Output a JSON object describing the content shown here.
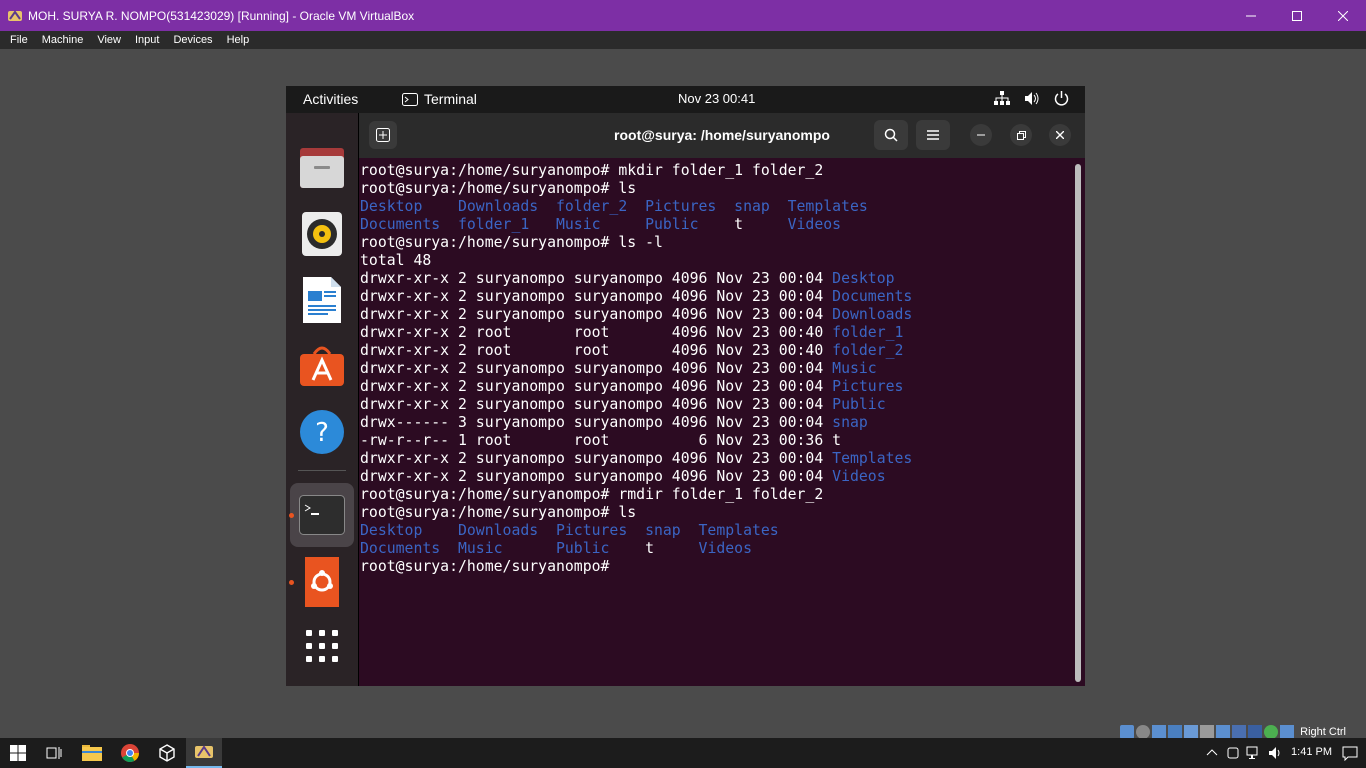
{
  "window": {
    "title": "MOH. SURYA R. NOMPO(531423029) [Running] - Oracle VM VirtualBox"
  },
  "menu": [
    "File",
    "Machine",
    "View",
    "Input",
    "Devices",
    "Help"
  ],
  "topbar": {
    "activities": "Activities",
    "app": "Terminal",
    "clock": "Nov 23  00:41"
  },
  "dock": {
    "items": [
      "files-icon",
      "rhythmbox-icon",
      "libreoffice-writer-icon",
      "app-center-icon",
      "help-icon",
      "terminal-icon",
      "ubuntu-icon",
      "show-apps-icon"
    ]
  },
  "terminal": {
    "title": "root@surya: /home/suryanompo",
    "lines": [
      [
        [
          "root@surya:/home/suryanompo# mkdir folder_1 folder_2",
          "w"
        ]
      ],
      [
        [
          "root@surya:/home/suryanompo# ls",
          "w"
        ]
      ],
      [
        [
          "Desktop    Downloads  folder_2  Pictures  snap  Templates",
          "b"
        ]
      ],
      [
        [
          "Documents  folder_1   Music     Public    ",
          "b"
        ],
        [
          "t",
          "w"
        ],
        [
          "     Videos",
          "b"
        ]
      ],
      [
        [
          "root@surya:/home/suryanompo# ls -l",
          "w"
        ]
      ],
      [
        [
          "total 48",
          "w"
        ]
      ],
      [
        [
          "drwxr-xr-x 2 suryanompo suryanompo 4096 Nov 23 00:04 ",
          "w"
        ],
        [
          "Desktop",
          "b"
        ]
      ],
      [
        [
          "drwxr-xr-x 2 suryanompo suryanompo 4096 Nov 23 00:04 ",
          "w"
        ],
        [
          "Documents",
          "b"
        ]
      ],
      [
        [
          "drwxr-xr-x 2 suryanompo suryanompo 4096 Nov 23 00:04 ",
          "w"
        ],
        [
          "Downloads",
          "b"
        ]
      ],
      [
        [
          "drwxr-xr-x 2 root       root       4096 Nov 23 00:40 ",
          "w"
        ],
        [
          "folder_1",
          "b"
        ]
      ],
      [
        [
          "drwxr-xr-x 2 root       root       4096 Nov 23 00:40 ",
          "w"
        ],
        [
          "folder_2",
          "b"
        ]
      ],
      [
        [
          "drwxr-xr-x 2 suryanompo suryanompo 4096 Nov 23 00:04 ",
          "w"
        ],
        [
          "Music",
          "b"
        ]
      ],
      [
        [
          "drwxr-xr-x 2 suryanompo suryanompo 4096 Nov 23 00:04 ",
          "w"
        ],
        [
          "Pictures",
          "b"
        ]
      ],
      [
        [
          "drwxr-xr-x 2 suryanompo suryanompo 4096 Nov 23 00:04 ",
          "w"
        ],
        [
          "Public",
          "b"
        ]
      ],
      [
        [
          "drwx------ 3 suryanompo suryanompo 4096 Nov 23 00:04 ",
          "w"
        ],
        [
          "snap",
          "b"
        ]
      ],
      [
        [
          "-rw-r--r-- 1 root       root          6 Nov 23 00:36 t",
          "w"
        ]
      ],
      [
        [
          "drwxr-xr-x 2 suryanompo suryanompo 4096 Nov 23 00:04 ",
          "w"
        ],
        [
          "Templates",
          "b"
        ]
      ],
      [
        [
          "drwxr-xr-x 2 suryanompo suryanompo 4096 Nov 23 00:04 ",
          "w"
        ],
        [
          "Videos",
          "b"
        ]
      ],
      [
        [
          "root@surya:/home/suryanompo# rmdir folder_1 folder_2",
          "w"
        ]
      ],
      [
        [
          "root@surya:/home/suryanompo# ls",
          "w"
        ]
      ],
      [
        [
          "Desktop    Downloads  Pictures  snap  Templates",
          "b"
        ]
      ],
      [
        [
          "Documents  Music      Public    ",
          "b"
        ],
        [
          "t",
          "w"
        ],
        [
          "     Videos",
          "b"
        ]
      ],
      [
        [
          "root@surya:/home/suryanompo# ",
          "w"
        ]
      ]
    ]
  },
  "tray": {
    "host_key": "Right Ctrl"
  },
  "taskbar": {
    "time": "1:41 PM"
  },
  "colors": {
    "vb_title": "#7d2fa5",
    "terminal_bg": "#2c0b22",
    "dir_blue": "#3b65c4",
    "ubuntu_orange": "#e95420"
  }
}
